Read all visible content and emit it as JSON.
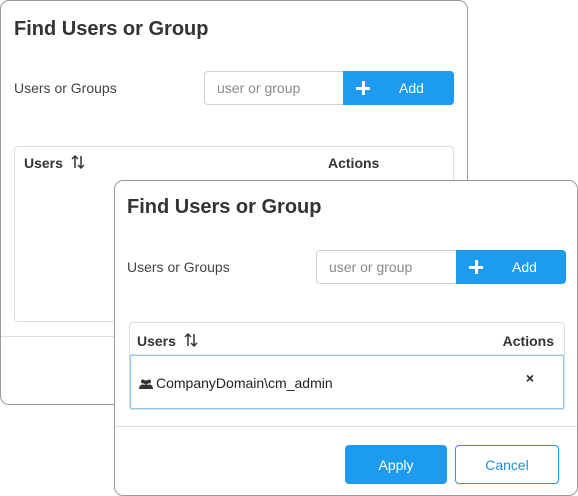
{
  "dialog": {
    "title": "Find Users or Group",
    "field_label": "Users or Groups",
    "search": {
      "placeholder": "user or group",
      "value": ""
    },
    "add_label": "Add",
    "table": {
      "columns": [
        "Users",
        "Actions"
      ]
    }
  },
  "front_dialog": {
    "rows": [
      {
        "name": "CompanyDomain\\cm_admin",
        "icon": "group-icon",
        "action": "×"
      }
    ],
    "apply_label": "Apply",
    "cancel_label": "Cancel"
  },
  "colors": {
    "accent": "#1d9bf0",
    "border": "#9a9a9a",
    "selected_row_border": "#8fc8f0"
  }
}
